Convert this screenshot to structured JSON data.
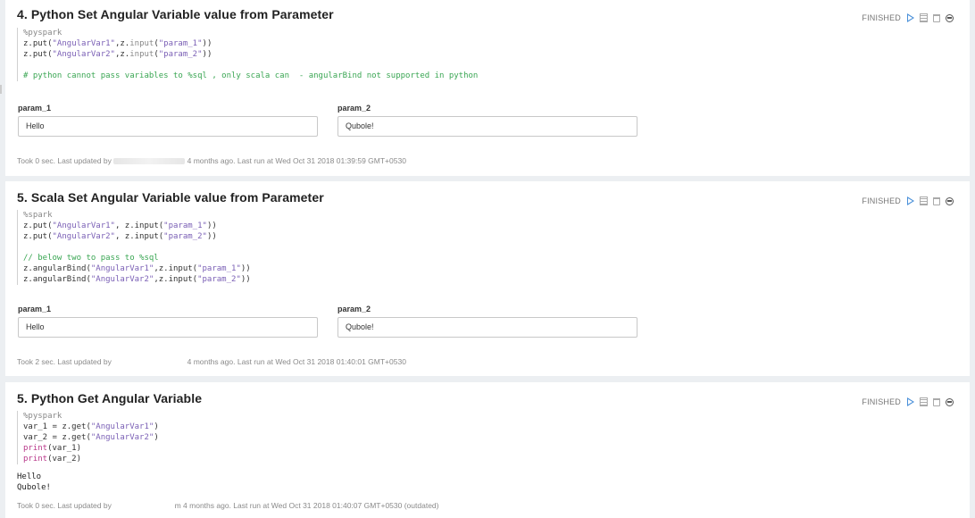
{
  "paragraphs": [
    {
      "title": "4. Python Set Angular Variable value from Parameter",
      "status": "FINISHED",
      "code": [
        [
          {
            "t": "%pyspark",
            "c": "kw"
          }
        ],
        [
          {
            "t": "z.put(",
            "c": ""
          },
          {
            "t": "\"AngularVar1\"",
            "c": "str"
          },
          {
            "t": ",z.",
            "c": ""
          },
          {
            "t": "input",
            "c": "kw"
          },
          {
            "t": "(",
            "c": ""
          },
          {
            "t": "\"param_1\"",
            "c": "str"
          },
          {
            "t": "))",
            "c": ""
          }
        ],
        [
          {
            "t": "z.put(",
            "c": ""
          },
          {
            "t": "\"AngularVar2\"",
            "c": "str"
          },
          {
            "t": ",z.",
            "c": ""
          },
          {
            "t": "input",
            "c": "kw"
          },
          {
            "t": "(",
            "c": ""
          },
          {
            "t": "\"param_2\"",
            "c": "str"
          },
          {
            "t": "))",
            "c": ""
          }
        ],
        [
          {
            "t": "",
            "c": ""
          }
        ],
        [
          {
            "t": "# python cannot pass variables to %sql , only scala can  - angularBind not supported in python",
            "c": "cm"
          }
        ]
      ],
      "params": [
        {
          "label": "param_1",
          "value": "Hello"
        },
        {
          "label": "param_2",
          "value": "Qubole!"
        }
      ],
      "footer_pre": "Took 0 sec. Last updated by",
      "footer_post": "4 months ago. Last run at Wed Oct 31 2018 01:39:59 GMT+0530"
    },
    {
      "title": "5. Scala Set Angular Variable value from Parameter",
      "status": "FINISHED",
      "code": [
        [
          {
            "t": "%spark",
            "c": "kw"
          }
        ],
        [
          {
            "t": "z.put(",
            "c": ""
          },
          {
            "t": "\"AngularVar1\"",
            "c": "str"
          },
          {
            "t": ", z.input(",
            "c": ""
          },
          {
            "t": "\"param_1\"",
            "c": "str"
          },
          {
            "t": "))",
            "c": ""
          }
        ],
        [
          {
            "t": "z.put(",
            "c": ""
          },
          {
            "t": "\"AngularVar2\"",
            "c": "str"
          },
          {
            "t": ", z.input(",
            "c": ""
          },
          {
            "t": "\"param_2\"",
            "c": "str"
          },
          {
            "t": "))",
            "c": ""
          }
        ],
        [
          {
            "t": "",
            "c": ""
          }
        ],
        [
          {
            "t": "// below two to pass to %sql",
            "c": "cm"
          }
        ],
        [
          {
            "t": "z.angularBind(",
            "c": ""
          },
          {
            "t": "\"AngularVar1\"",
            "c": "str"
          },
          {
            "t": ",z.input(",
            "c": ""
          },
          {
            "t": "\"param_1\"",
            "c": "str"
          },
          {
            "t": "))",
            "c": ""
          }
        ],
        [
          {
            "t": "z.angularBind(",
            "c": ""
          },
          {
            "t": "\"AngularVar2\"",
            "c": "str"
          },
          {
            "t": ",z.input(",
            "c": ""
          },
          {
            "t": "\"param_2\"",
            "c": "str"
          },
          {
            "t": "))",
            "c": ""
          }
        ]
      ],
      "params": [
        {
          "label": "param_1",
          "value": "Hello"
        },
        {
          "label": "param_2",
          "value": "Qubole!"
        }
      ],
      "footer_pre": "Took 2 sec. Last updated by",
      "footer_post": "4 months ago. Last run at Wed Oct 31 2018 01:40:01 GMT+0530"
    },
    {
      "title": "5. Python Get Angular Variable",
      "status": "FINISHED",
      "code": [
        [
          {
            "t": "%pyspark",
            "c": "kw"
          }
        ],
        [
          {
            "t": "var_1 = z.get(",
            "c": ""
          },
          {
            "t": "\"AngularVar1\"",
            "c": "str"
          },
          {
            "t": ")",
            "c": ""
          }
        ],
        [
          {
            "t": "var_2 = z.get(",
            "c": ""
          },
          {
            "t": "\"AngularVar2\"",
            "c": "str"
          },
          {
            "t": ")",
            "c": ""
          }
        ],
        [
          {
            "t": "print",
            "c": "pr"
          },
          {
            "t": "(var_1)",
            "c": ""
          }
        ],
        [
          {
            "t": "print",
            "c": "pr"
          },
          {
            "t": "(var_2)",
            "c": ""
          }
        ]
      ],
      "output": [
        "Hello",
        "Qubole!"
      ],
      "footer_pre": "Took 0 sec. Last updated by",
      "footer_post": "m 4 months ago. Last run at Wed Oct 31 2018 01:40:07 GMT+0530 (outdated)"
    }
  ],
  "icons": [
    "run-play-icon",
    "table-toggle-icon",
    "trash-icon",
    "minimize-icon"
  ],
  "colors": {
    "accent": "#4a90d9",
    "comment": "#3aa653",
    "string": "#7a5fb5",
    "background": "#eceff2"
  }
}
